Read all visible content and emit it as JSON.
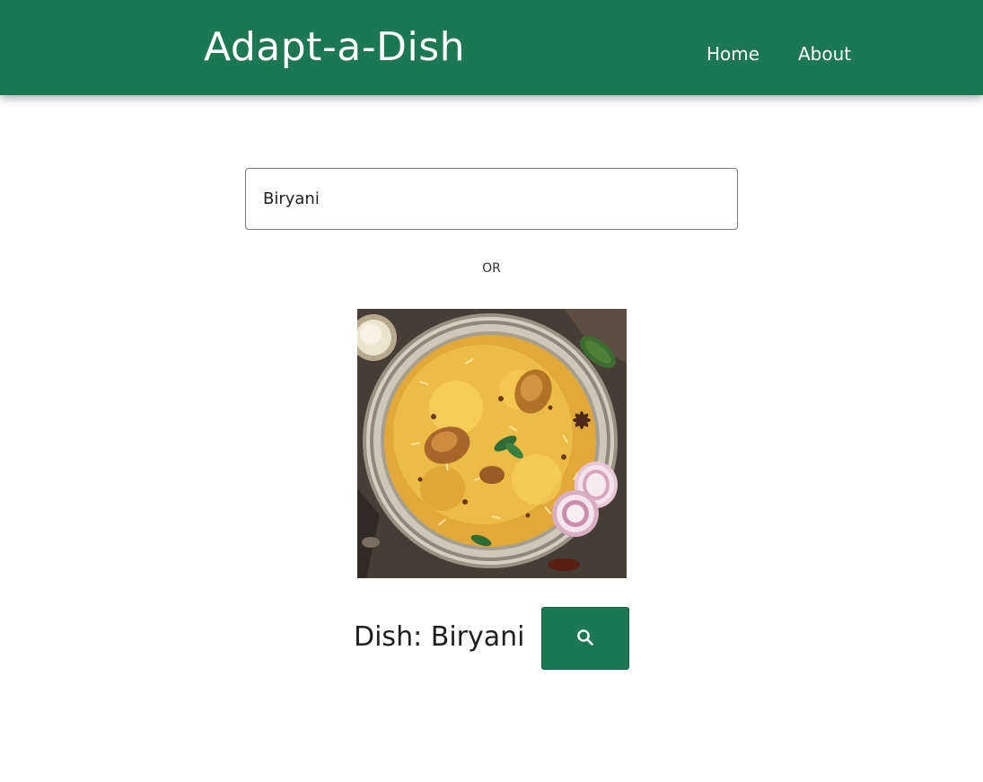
{
  "header": {
    "brand": "Adapt-a-Dish",
    "nav": [
      {
        "label": "Home"
      },
      {
        "label": "About"
      }
    ]
  },
  "main": {
    "search": {
      "value": "Biryani",
      "placeholder": ""
    },
    "separator": "OR",
    "image": {
      "alt": "Biryani"
    },
    "dish_prefix": "Dish:",
    "dish_name": "Biryani",
    "search_button_icon": "search-icon"
  },
  "colors": {
    "brand_green": "#1c7753",
    "header_text": "#ffffff",
    "page_background": "#ffffff"
  }
}
